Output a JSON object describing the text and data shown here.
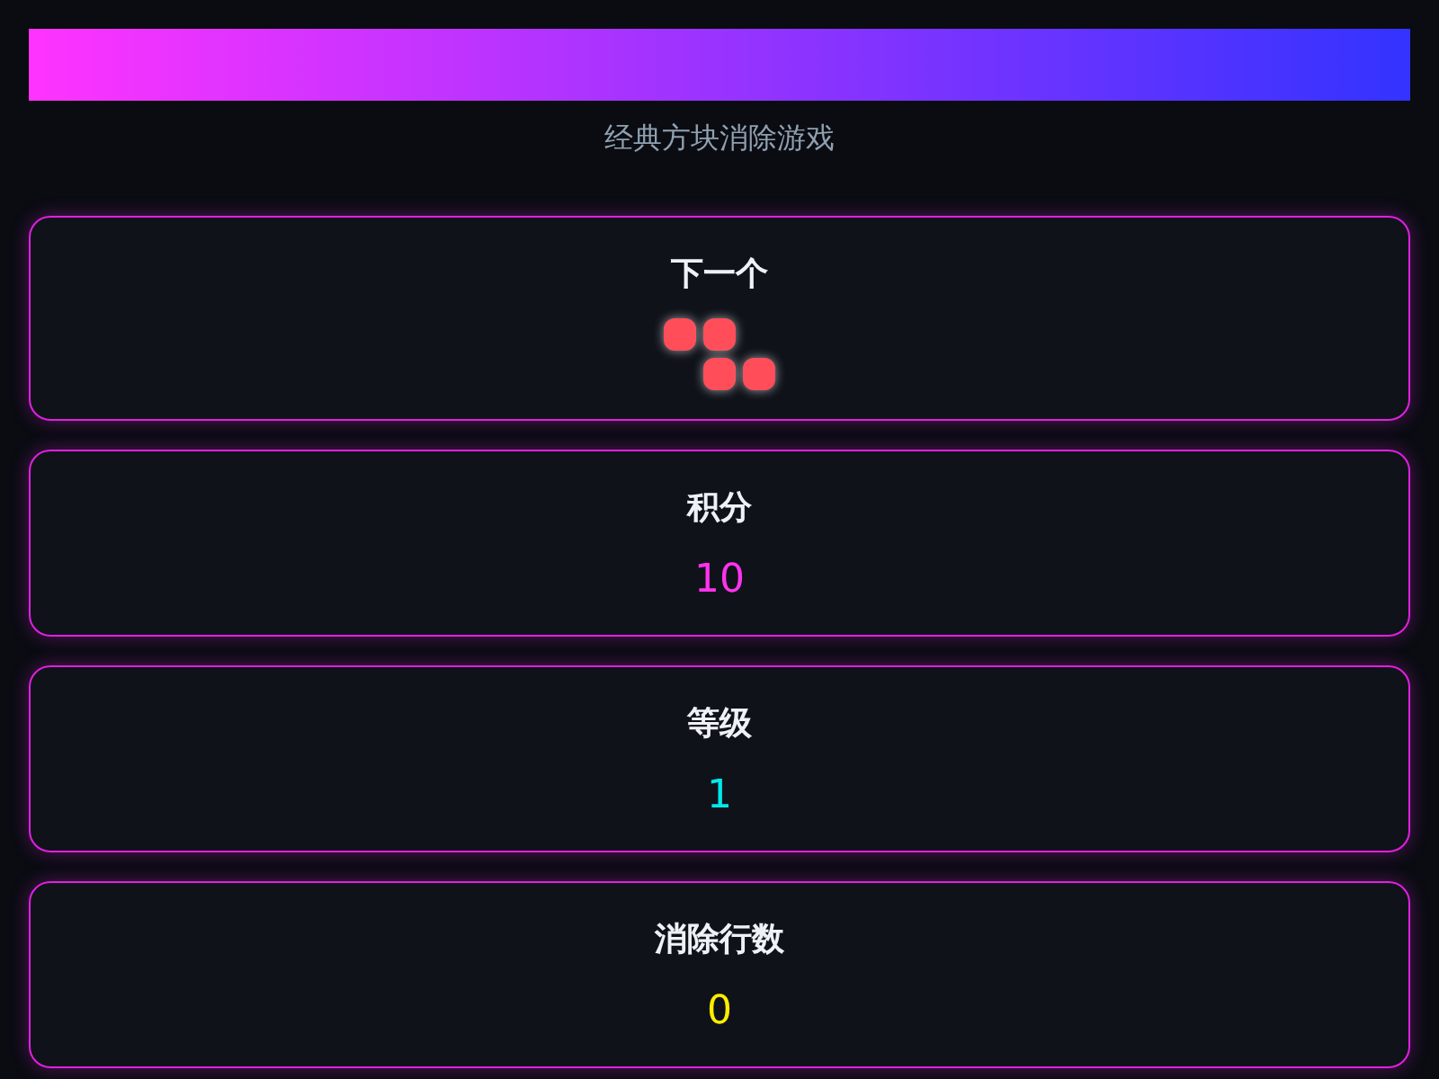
{
  "header": {
    "subtitle": "经典方块消除游戏"
  },
  "next_piece": {
    "title": "下一个",
    "color": "#ff4d5a",
    "cells": [
      [
        true,
        true,
        false
      ],
      [
        false,
        true,
        true
      ]
    ]
  },
  "stats": [
    {
      "label": "积分",
      "value": "10",
      "color": "#ff33ee"
    },
    {
      "label": "等级",
      "value": "1",
      "color": "#00eaea"
    },
    {
      "label": "消除行数",
      "value": "0",
      "color": "#ffee00"
    }
  ]
}
